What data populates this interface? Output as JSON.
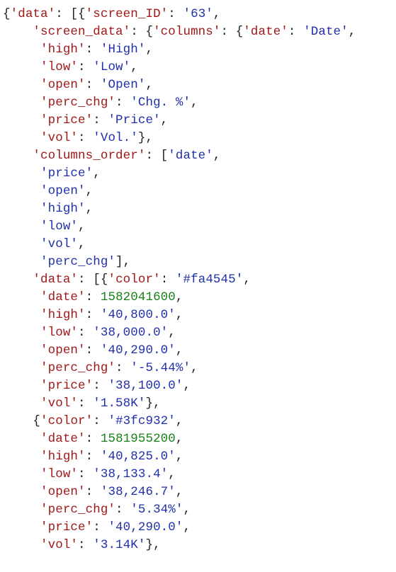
{
  "indent": {
    "l0": "",
    "l1": "    ",
    "l2": "     ",
    "l3": "      "
  },
  "lines": [
    {
      "i": "l0",
      "pre": "{",
      "k": "'data'",
      "post": ": [{",
      "k2": "'screen_ID'",
      "tail": ": ",
      "v": "'63'",
      "end": ","
    },
    {
      "i": "l1",
      "pre": "",
      "k": "'screen_data'",
      "post": ": {",
      "k2": "'columns'",
      "tail": ": {",
      "k3": "'date'",
      "tail2": ": ",
      "v": "'Date'",
      "end": ","
    },
    {
      "i": "l2",
      "pre": "",
      "k": "'high'",
      "post": ": ",
      "v": "'High'",
      "end": ","
    },
    {
      "i": "l2",
      "pre": "",
      "k": "'low'",
      "post": ": ",
      "v": "'Low'",
      "end": ","
    },
    {
      "i": "l2",
      "pre": "",
      "k": "'open'",
      "post": ": ",
      "v": "'Open'",
      "end": ","
    },
    {
      "i": "l2",
      "pre": "",
      "k": "'perc_chg'",
      "post": ": ",
      "v": "'Chg. %'",
      "end": ","
    },
    {
      "i": "l2",
      "pre": "",
      "k": "'price'",
      "post": ": ",
      "v": "'Price'",
      "end": ","
    },
    {
      "i": "l2",
      "pre": "",
      "k": "'vol'",
      "post": ": ",
      "v": "'Vol.'",
      "end": "},"
    },
    {
      "i": "l1",
      "pre": "",
      "k": "'columns_order'",
      "post": ": [",
      "v": "'date'",
      "end": ","
    },
    {
      "i": "l2",
      "pre": "",
      "v": "'price'",
      "end": ","
    },
    {
      "i": "l2",
      "pre": "",
      "v": "'open'",
      "end": ","
    },
    {
      "i": "l2",
      "pre": "",
      "v": "'high'",
      "end": ","
    },
    {
      "i": "l2",
      "pre": "",
      "v": "'low'",
      "end": ","
    },
    {
      "i": "l2",
      "pre": "",
      "v": "'vol'",
      "end": ","
    },
    {
      "i": "l2",
      "pre": "",
      "v": "'perc_chg'",
      "end": "],"
    },
    {
      "i": "l1",
      "pre": "",
      "k": "'data'",
      "post": ": [{",
      "k2": "'color'",
      "tail": ": ",
      "v": "'#fa4545'",
      "end": ","
    },
    {
      "i": "l2",
      "pre": "",
      "k": "'date'",
      "post": ": ",
      "n": "1582041600",
      "end": ","
    },
    {
      "i": "l2",
      "pre": "",
      "k": "'high'",
      "post": ": ",
      "v": "'40,800.0'",
      "end": ","
    },
    {
      "i": "l2",
      "pre": "",
      "k": "'low'",
      "post": ": ",
      "v": "'38,000.0'",
      "end": ","
    },
    {
      "i": "l2",
      "pre": "",
      "k": "'open'",
      "post": ": ",
      "v": "'40,290.0'",
      "end": ","
    },
    {
      "i": "l2",
      "pre": "",
      "k": "'perc_chg'",
      "post": ": ",
      "v": "'-5.44%'",
      "end": ","
    },
    {
      "i": "l2",
      "pre": "",
      "k": "'price'",
      "post": ": ",
      "v": "'38,100.0'",
      "end": ","
    },
    {
      "i": "l2",
      "pre": "",
      "k": "'vol'",
      "post": ": ",
      "v": "'1.58K'",
      "end": "},"
    },
    {
      "i": "l1",
      "pre": "{",
      "k": "'color'",
      "post": ": ",
      "v": "'#3fc932'",
      "end": ","
    },
    {
      "i": "l2",
      "pre": "",
      "k": "'date'",
      "post": ": ",
      "n": "1581955200",
      "end": ","
    },
    {
      "i": "l2",
      "pre": "",
      "k": "'high'",
      "post": ": ",
      "v": "'40,825.0'",
      "end": ","
    },
    {
      "i": "l2",
      "pre": "",
      "k": "'low'",
      "post": ": ",
      "v": "'38,133.4'",
      "end": ","
    },
    {
      "i": "l2",
      "pre": "",
      "k": "'open'",
      "post": ": ",
      "v": "'38,246.7'",
      "end": ","
    },
    {
      "i": "l2",
      "pre": "",
      "k": "'perc_chg'",
      "post": ": ",
      "v": "'5.34%'",
      "end": ","
    },
    {
      "i": "l2",
      "pre": "",
      "k": "'price'",
      "post": ": ",
      "v": "'40,290.0'",
      "end": ","
    },
    {
      "i": "l2",
      "pre": "",
      "k": "'vol'",
      "post": ": ",
      "v": "'3.14K'",
      "end": "},"
    }
  ]
}
